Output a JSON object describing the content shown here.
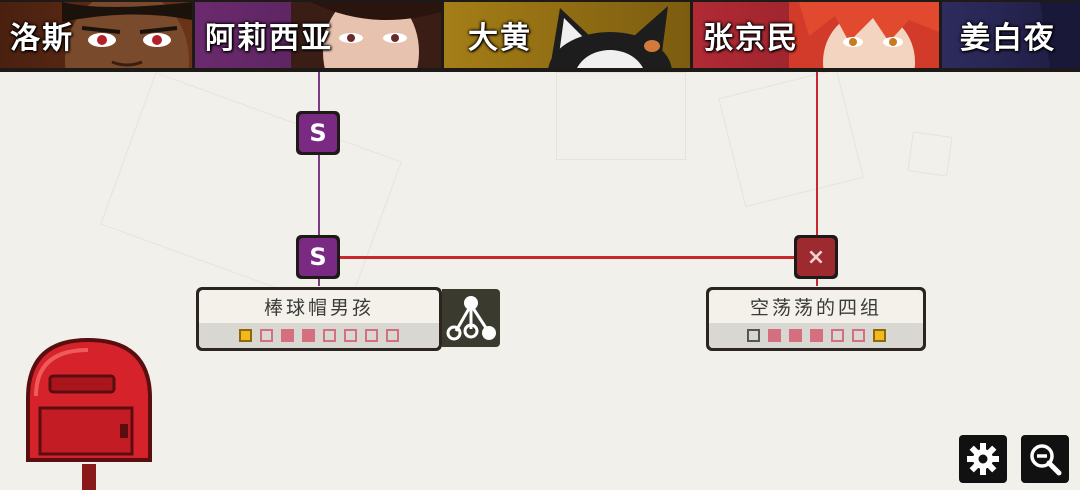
{
  "characters": [
    {
      "name": "洛斯",
      "color": "#5a2a12"
    },
    {
      "name": "阿莉西亚",
      "color": "#6b2a6e"
    },
    {
      "name": "大黄",
      "color": "#9c7a14"
    },
    {
      "name": "张京民",
      "color": "#a32630"
    },
    {
      "name": "姜白夜",
      "color": "#2e2c5e"
    }
  ],
  "nodes": {
    "alicia_top": {
      "label": "S",
      "color": "#7a2a82"
    },
    "alicia_mid": {
      "label": "S",
      "color": "#7a2a82"
    },
    "zhang_mid": {
      "label": "×",
      "color": "#9c2a2e"
    }
  },
  "cards": [
    {
      "title": "棒球帽男孩",
      "boxes": [
        "gold",
        "empty",
        "filled",
        "filled",
        "empty",
        "empty",
        "empty",
        "empty"
      ]
    },
    {
      "title": "空荡荡的四组",
      "boxes": [
        "dark",
        "filled",
        "filled",
        "filled",
        "empty",
        "empty",
        "gold"
      ]
    }
  ],
  "buttons": {
    "settings": "gear-icon",
    "zoom_out": "zoom-out-icon",
    "mailbox": "mailbox-icon",
    "tree": "tree-icon"
  },
  "colors": {
    "alicia_line": "#7a3a86",
    "zhang_line": "#c8272e",
    "link_line": "#c8272e"
  }
}
